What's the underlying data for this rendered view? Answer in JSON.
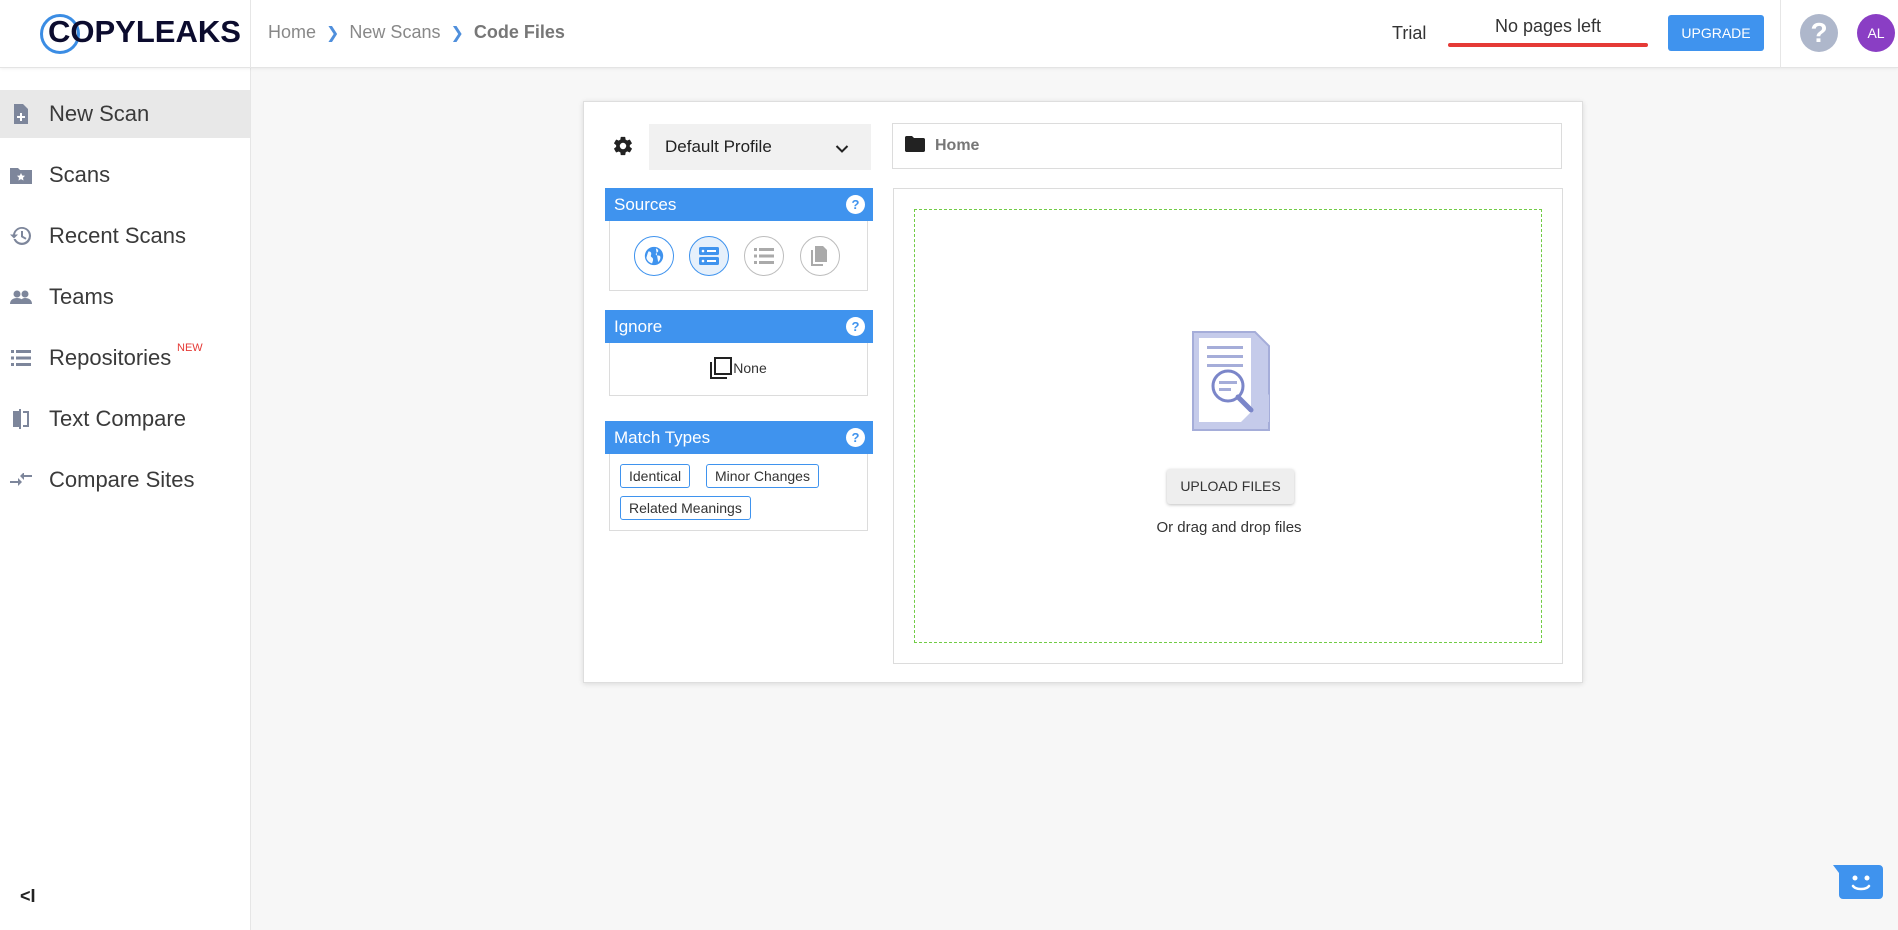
{
  "header": {
    "logo_text": "COPYLEAKS",
    "breadcrumb": [
      "Home",
      "New Scans",
      "Code Files"
    ],
    "trial_label": "Trial",
    "pages_left": "No pages left",
    "upgrade_label": "UPGRADE",
    "help_icon": "help-icon",
    "avatar_initials": "AL"
  },
  "sidebar": {
    "items": [
      {
        "label": "New Scan",
        "icon": "new-scan-icon",
        "active": true
      },
      {
        "label": "Scans",
        "icon": "folder-star-icon"
      },
      {
        "label": "Recent Scans",
        "icon": "history-icon"
      },
      {
        "label": "Teams",
        "icon": "people-icon"
      },
      {
        "label": "Repositories",
        "icon": "list-icon",
        "badge": "NEW"
      },
      {
        "label": "Text Compare",
        "icon": "compare-icon"
      },
      {
        "label": "Compare Sites",
        "icon": "compare-arrows-icon"
      }
    ],
    "collapse_label": "<I"
  },
  "scan": {
    "profile_label": "Default Profile",
    "path_label": "Home",
    "sources": {
      "title": "Sources",
      "help": "?"
    },
    "ignore": {
      "title": "Ignore",
      "help": "?",
      "value": "None"
    },
    "match_types": {
      "title": "Match Types",
      "help": "?",
      "chips": [
        "Identical",
        "Minor Changes",
        "Related Meanings"
      ]
    },
    "upload_label": "UPLOAD FILES",
    "drag_text": "Or drag and drop files"
  },
  "colors": {
    "accent": "#3f93ee",
    "danger": "#e53a36",
    "avatar": "#8a3ec4",
    "dropzone": "#71cc45"
  }
}
